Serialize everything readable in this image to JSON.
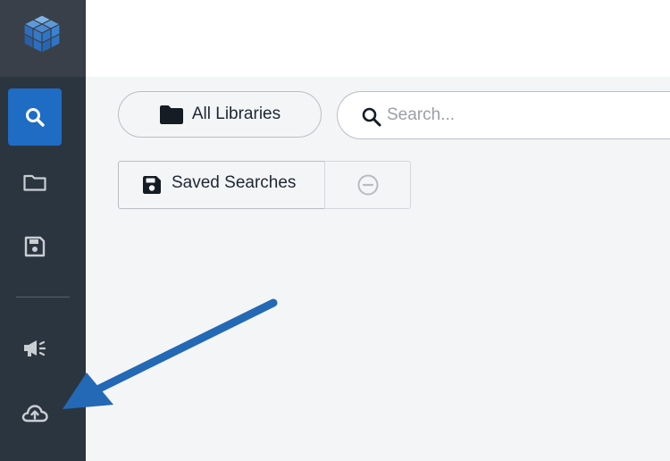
{
  "sidebar": {
    "logo_icon": "cube-logo-icon",
    "items": [
      {
        "icon": "search-icon",
        "active": true
      },
      {
        "icon": "folder-icon",
        "active": false
      },
      {
        "icon": "save-icon",
        "active": false
      },
      {
        "icon": "megaphone-icon",
        "active": false
      },
      {
        "icon": "cloud-upload-icon",
        "active": false
      }
    ]
  },
  "toolbar": {
    "library_label": "All Libraries",
    "search_placeholder": "Search..."
  },
  "saved_searches": {
    "label": "Saved Searches",
    "remove_icon": "minus-circle-icon"
  },
  "colors": {
    "sidebar_bg": "#2b3540",
    "accent": "#1f6cc4",
    "annotation_arrow": "#2369b5"
  }
}
